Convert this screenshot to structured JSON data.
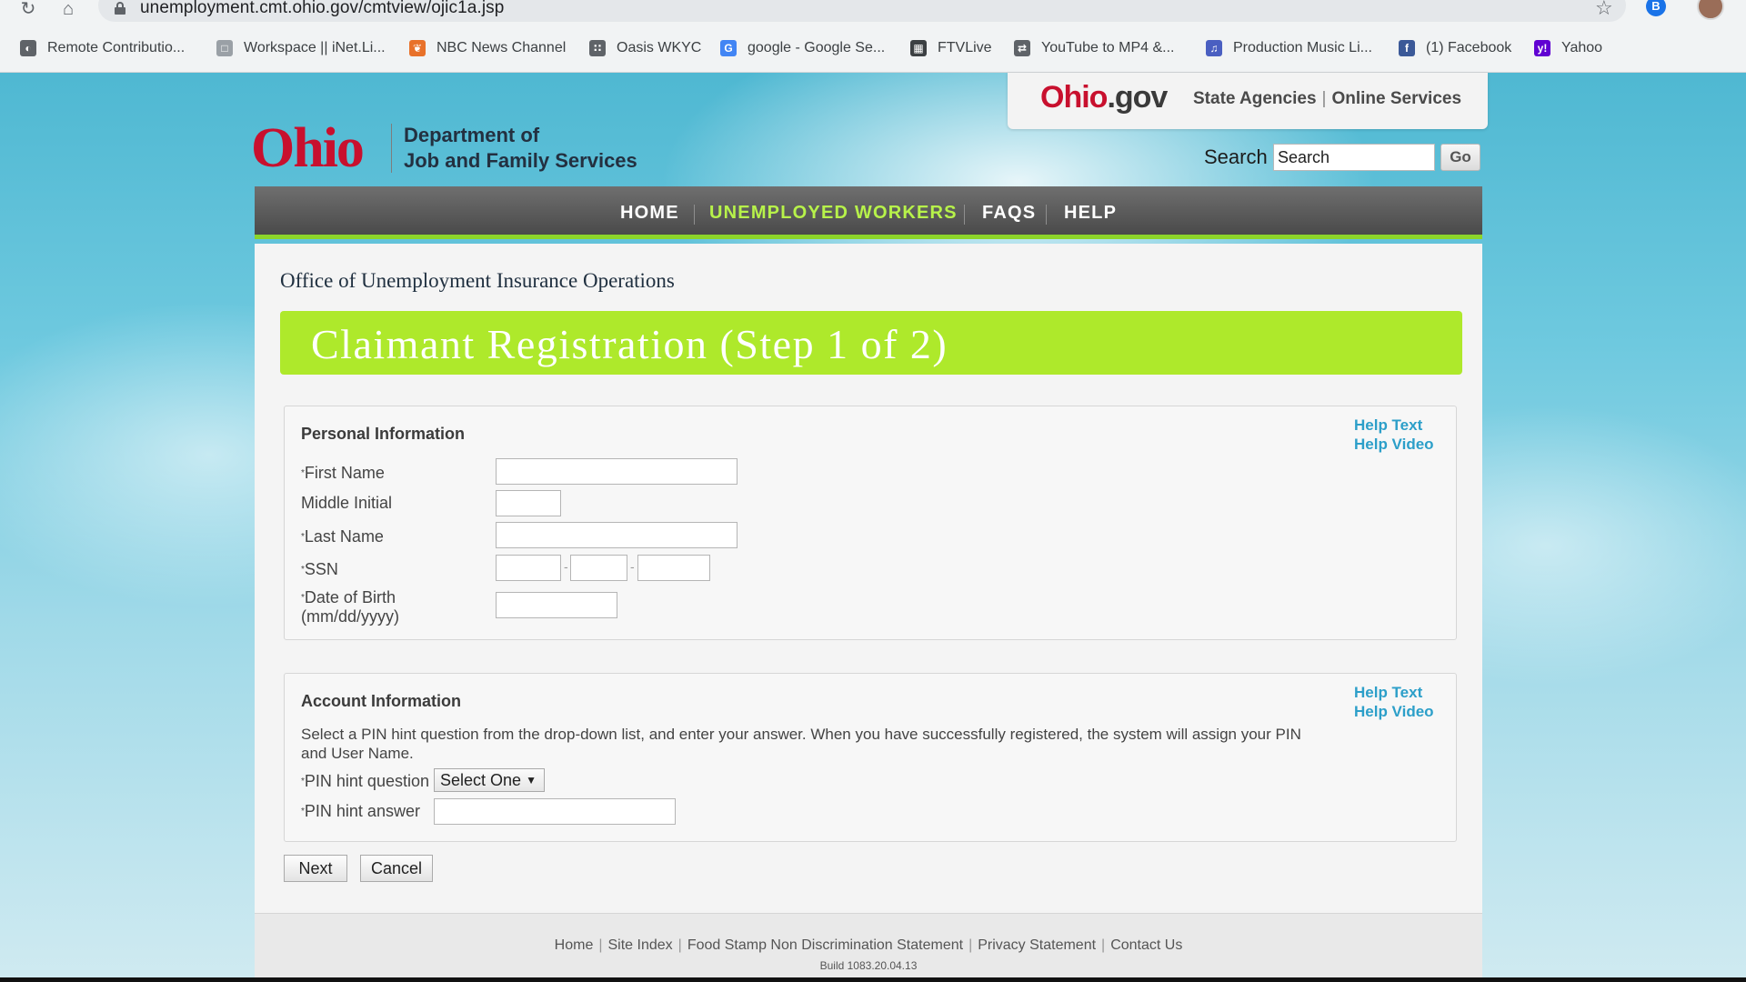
{
  "browser": {
    "url": "unemployment.cmt.ohio.gov/cmtview/ojic1a.jsp",
    "bookmarks": [
      {
        "label": "Remote Contributio...",
        "icon": "remote-icon",
        "color": "#5f6368"
      },
      {
        "label": "Workspace || iNet.Li...",
        "icon": "page-icon",
        "color": "#9aa0a6"
      },
      {
        "label": "NBC News Channel",
        "icon": "nbc-peacock-icon",
        "color": "#e8712a"
      },
      {
        "label": "Oasis WKYC",
        "icon": "grid-icon",
        "color": "#5f6368"
      },
      {
        "label": "google - Google Se...",
        "icon": "google-icon",
        "color": "#4285f4"
      },
      {
        "label": "FTVLive",
        "icon": "ftvlive-icon",
        "color": "#3c4043"
      },
      {
        "label": "YouTube to MP4 &...",
        "icon": "convert-icon",
        "color": "#5f6368"
      },
      {
        "label": "Production Music Li...",
        "icon": "music-icon",
        "color": "#4a5fc1"
      },
      {
        "label": "(1) Facebook",
        "icon": "facebook-icon",
        "color": "#3b5998"
      },
      {
        "label": "Yahoo",
        "icon": "yahoo-icon",
        "color": "#6001d2"
      }
    ]
  },
  "ohio_gov": {
    "logo_part1": "Ohio",
    "logo_part2": ".gov",
    "link_state_agencies": "State Agencies",
    "link_online_services": "Online Services"
  },
  "header": {
    "logo": "Ohio",
    "dept_line1": "Department of",
    "dept_line2": "Job and Family Services",
    "search_label": "Search",
    "search_value": "Search",
    "go_label": "Go"
  },
  "nav": {
    "home": "HOME",
    "unemployed_workers": "UNEMPLOYED WORKERS",
    "faqs": "FAQS",
    "help": "HELP"
  },
  "content": {
    "office_title": "Office of Unemployment Insurance Operations",
    "banner_title": "Claimant Registration (Step 1 of 2)"
  },
  "personal": {
    "title": "Personal Information",
    "help_text": "Help Text",
    "help_video": "Help Video",
    "first_name": "First Name",
    "middle_initial": "Middle Initial",
    "last_name": "Last Name",
    "ssn": "SSN",
    "dob_line1": "Date of Birth",
    "dob_line2": "(mm/dd/yyyy)",
    "required_mark": "*"
  },
  "account": {
    "title": "Account Information",
    "help_text": "Help Text",
    "help_video": "Help Video",
    "description": "Select a PIN hint question from the drop-down list, and enter your answer. When you have successfully registered, the system will assign your PIN and User Name.",
    "pin_hint_question": "PIN hint question",
    "pin_hint_select": "Select One",
    "pin_hint_answer": "PIN hint answer",
    "required_mark": "*"
  },
  "buttons": {
    "next": "Next",
    "cancel": "Cancel"
  },
  "footer": {
    "links": [
      "Home",
      "Site Index",
      "Food Stamp Non Discrimination Statement",
      "Privacy Statement",
      "Contact Us"
    ],
    "build": "Build 1083.20.04.13"
  },
  "colors": {
    "accent_green": "#aee92b",
    "nav_active": "#b7f24a",
    "ohio_red": "#c8102e",
    "help_link": "#2c9fc9"
  }
}
